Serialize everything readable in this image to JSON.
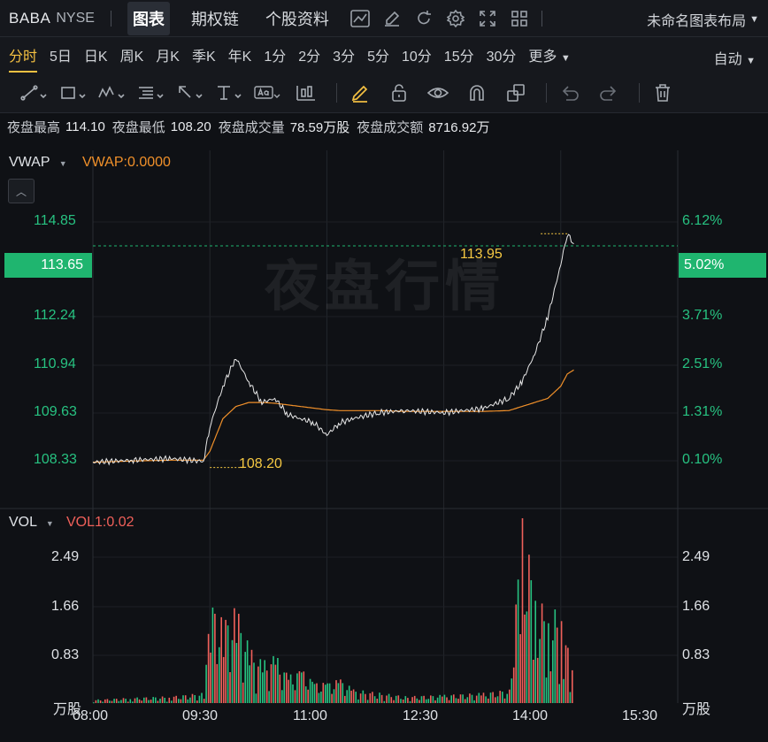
{
  "header": {
    "ticker": "BABA",
    "exchange": "NYSE",
    "tabs": [
      {
        "label": "图表",
        "active": true
      },
      {
        "label": "期权链",
        "active": false
      },
      {
        "label": "个股资料",
        "active": false
      }
    ],
    "toolbar_icons": [
      "line-chart-icon",
      "edit-icon",
      "refresh-icon",
      "gear-icon",
      "fullscreen-icon",
      "grid-icon"
    ],
    "layout_label": "未命名图表布局"
  },
  "periods": {
    "items": [
      "分时",
      "5日",
      "日K",
      "周K",
      "月K",
      "季K",
      "年K",
      "1分",
      "2分",
      "3分",
      "5分",
      "10分",
      "15分",
      "30分",
      "更多"
    ],
    "active": "分时",
    "more_label": "更多",
    "auto_label": "自动"
  },
  "stats": {
    "high_label": "夜盘最高",
    "high": "114.10",
    "low_label": "夜盘最低",
    "low": "108.20",
    "vol_label": "夜盘成交量",
    "vol": "78.59万股",
    "amt_label": "夜盘成交额",
    "amt": "8716.92万"
  },
  "price_panel": {
    "indicator": "VWAP",
    "indicator_value": "VWAP:0.0000",
    "watermark": "夜盘行情",
    "current_price": "113.65",
    "current_pct": "5.02%",
    "high_mark": "113.95",
    "low_mark": "108.20",
    "y_ticks": [
      "114.85",
      "112.24",
      "110.94",
      "109.63",
      "108.33"
    ],
    "pct_ticks": [
      "6.12%",
      "3.71%",
      "2.51%",
      "1.31%",
      "0.10%"
    ]
  },
  "volume_panel": {
    "indicator": "VOL",
    "indicator_value": "VOL1:0.02",
    "y_ticks": [
      "2.49",
      "1.66",
      "0.83"
    ],
    "unit": "万股"
  },
  "time_axis": [
    "08:00",
    "09:30",
    "11:00",
    "12:30",
    "14:00",
    "15:30"
  ],
  "colors": {
    "up": "#27c281",
    "down": "#f0605a",
    "vwap": "#f0902a",
    "accent": "#f5c142",
    "price": "#e8e8e8"
  },
  "chart_data": {
    "type": "line",
    "x": [
      "08:00",
      "08:30",
      "09:00",
      "09:25",
      "09:30",
      "09:40",
      "09:50",
      "10:00",
      "10:10",
      "10:20",
      "10:30",
      "10:40",
      "10:50",
      "11:00",
      "11:10",
      "11:20",
      "11:40",
      "12:00",
      "12:30",
      "13:00",
      "13:20",
      "13:30",
      "13:40",
      "13:50",
      "14:00",
      "14:05",
      "14:10"
    ],
    "series": [
      {
        "name": "price",
        "values": [
          108.33,
          108.38,
          108.42,
          108.35,
          109.2,
          110.2,
          110.9,
          110.3,
          109.8,
          109.9,
          109.5,
          109.4,
          109.3,
          109.0,
          109.3,
          109.4,
          109.55,
          109.6,
          109.55,
          109.65,
          109.9,
          110.3,
          111.0,
          111.9,
          113.2,
          113.95,
          113.7
        ]
      },
      {
        "name": "VWAP",
        "values": [
          108.33,
          108.36,
          108.38,
          108.38,
          108.6,
          109.4,
          109.7,
          109.8,
          109.8,
          109.78,
          109.74,
          109.7,
          109.66,
          109.62,
          109.6,
          109.6,
          109.6,
          109.58,
          109.58,
          109.58,
          109.6,
          109.7,
          109.8,
          109.9,
          110.2,
          110.5,
          110.6
        ]
      }
    ],
    "volume": [
      0.05,
      0.08,
      0.1,
      0.15,
      1.5,
      1.2,
      1.4,
      0.8,
      0.6,
      0.7,
      0.4,
      0.5,
      0.3,
      0.3,
      0.35,
      0.2,
      0.15,
      0.1,
      0.12,
      0.15,
      0.2,
      2.8,
      1.6,
      1.3,
      1.4,
      1.0,
      0.4
    ],
    "ylim": [
      107.3,
      116.0
    ],
    "vol_ylim": [
      0,
      3.3
    ]
  }
}
